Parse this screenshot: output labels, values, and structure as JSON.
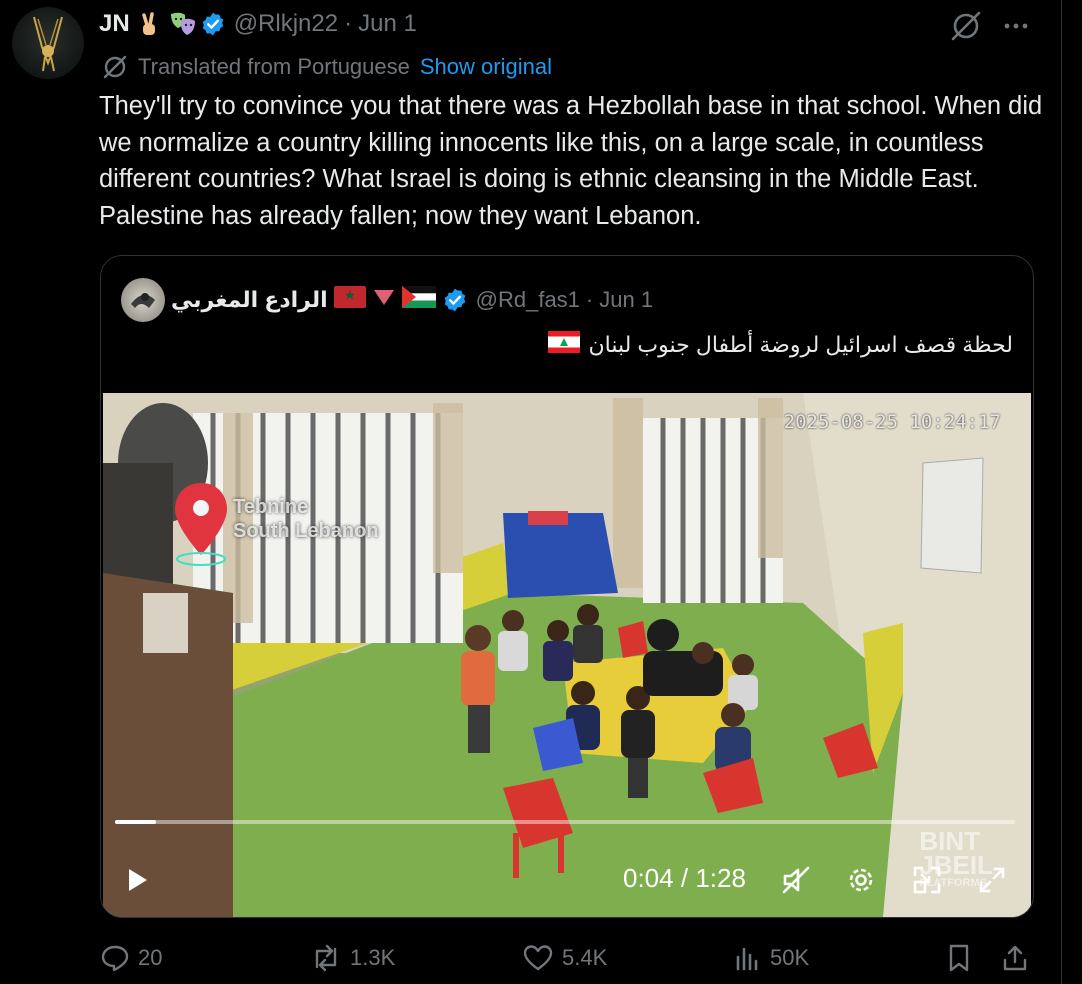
{
  "post": {
    "author_name": "JN",
    "handle": "@Rlkjn22",
    "separator": "·",
    "date": "Jun 1",
    "translated_label": "Translated from Portuguese",
    "show_original": "Show original",
    "text": "They'll try to convince you that there was a Hezbollah base in that school. When did we normalize a country killing innocents like this, on a large scale, in countless different countries? What Israel is doing is ethnic cleansing in the Middle East. Palestine has already fallen; now they want Lebanon."
  },
  "quote": {
    "author_name": "الرادع المغربي",
    "handle": "@Rd_fas1",
    "separator": "·",
    "date": "Jun 1",
    "text": "لحظة قصف اسرائيل لروضة أطفال جنوب لبنان"
  },
  "video": {
    "timestamp_overlay": "2025-08-25 10:24:17",
    "location_line1": "Tebnine",
    "location_line2": "South Lebanon",
    "watermark_line1": "BINT",
    "watermark_line2": "JBEIL",
    "watermark_line3": "PLATFORMS",
    "current_time": "0:04",
    "time_separator": "/",
    "duration": "1:28",
    "progress_fraction": 0.045
  },
  "actions": {
    "replies": "20",
    "reposts": "1.3K",
    "likes": "5.4K",
    "views": "50K"
  },
  "colors": {
    "background": "#000000",
    "text": "#e7e9ea",
    "muted": "#71767b",
    "link": "#1d9bf0",
    "verified": "#1d9bf0",
    "border": "#2f3336"
  },
  "icons": [
    "grok-icon",
    "more-icon",
    "translate-icon",
    "verified-badge-icon",
    "play-icon",
    "mute-icon",
    "settings-icon",
    "pip-icon",
    "fullscreen-icon",
    "reply-icon",
    "repost-icon",
    "like-icon",
    "views-icon",
    "bookmark-icon",
    "share-icon"
  ]
}
